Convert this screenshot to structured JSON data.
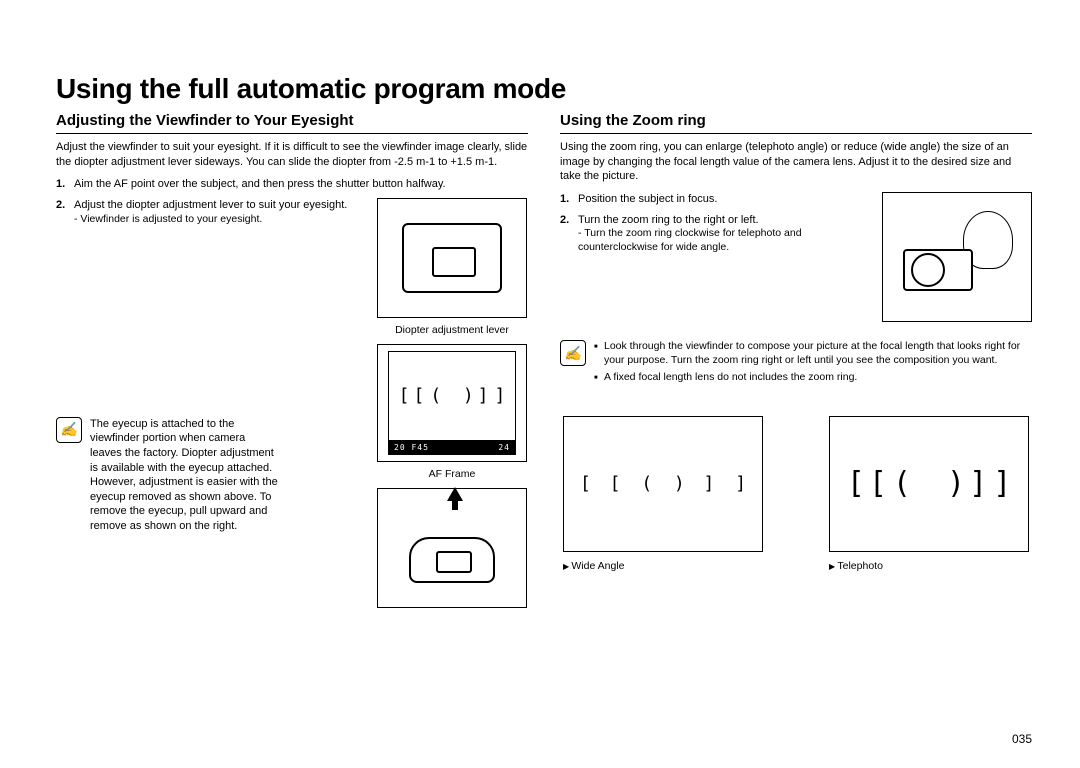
{
  "page_number": "035",
  "title": "Using the full automatic program mode",
  "left": {
    "heading": "Adjusting the Viewﬁnder to Your Eyesight",
    "intro": "Adjust the viewﬁnder to suit your eyesight. If it is difﬁcult to see the viewﬁnder image clearly, slide the diopter adjustment lever sideways. You can slide the diopter from -2.5 m-1 to +1.5 m-1.",
    "steps": [
      {
        "text": "Aim the AF point over the subject, and then press the shutter button halfway."
      },
      {
        "text": "Adjust the diopter adjustment lever to suit your eyesight.",
        "sub": "- Viewﬁnder is adjusted to your eyesight."
      }
    ],
    "fig_diopter_label": "Diopter adjustment lever",
    "fig_af_label": "AF Frame",
    "af_bar_left": "20 F45",
    "af_bar_right": "24",
    "note": "The eyecup is attached to the viewﬁnder portion when camera leaves the factory. Diopter adjustment is available with the eyecup attached. However, adjustment is easier with the eyecup removed as shown above. To remove the eyecup, pull upward and remove as shown on the right."
  },
  "right": {
    "heading": "Using the Zoom ring",
    "intro": "Using the zoom ring, you can enlarge (telephoto angle) or reduce (wide angle) the size of an image by changing the focal length value of the camera lens. Adjust it to the desired size and take the picture.",
    "steps": [
      {
        "text": "Position the subject in focus."
      },
      {
        "text": "Turn the zoom ring to the right or left.",
        "sub": "- Turn the zoom ring clockwise for telephoto and counterclockwise for wide angle."
      }
    ],
    "notes": [
      "Look through the viewﬁnder to compose your picture at the focal length that looks right for your purpose. Turn the zoom ring right or left until you see the composition you want.",
      "A ﬁxed focal length lens do not includes the zoom ring."
    ],
    "wide_label": "Wide Angle",
    "tele_label": "Telephoto"
  }
}
